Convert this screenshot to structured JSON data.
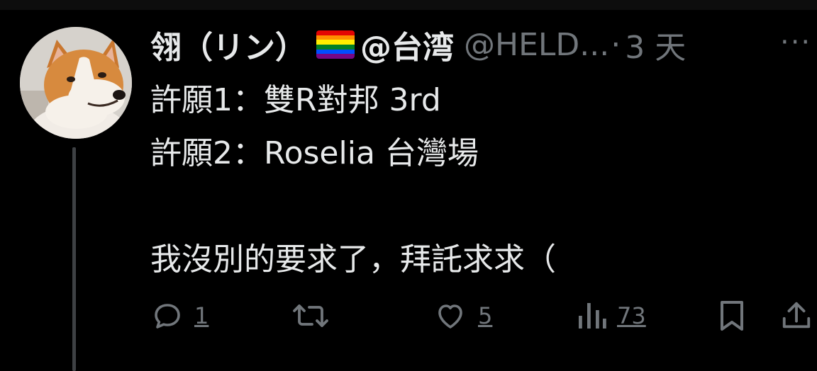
{
  "tweet": {
    "display_name": "翎（リン）",
    "name_suffix": "@台湾",
    "handle": "@HELD...",
    "separator": "·",
    "time": "3 天",
    "more_label": "···",
    "flag_colors": [
      "#e40303",
      "#ff8c00",
      "#ffed00",
      "#008026",
      "#004dff",
      "#750787"
    ],
    "lines": [
      "許願1：雙R對邦 3rd",
      "許願2：Roselia 台灣場",
      "",
      "我沒別的要求了，拜託求求（"
    ]
  },
  "actions": {
    "reply": {
      "icon": "reply-icon",
      "count": "1"
    },
    "retweet": {
      "icon": "retweet-icon",
      "count": ""
    },
    "like": {
      "icon": "heart-icon",
      "count": "5"
    },
    "views": {
      "icon": "views-icon",
      "count": "73"
    },
    "bookmark": {
      "icon": "bookmark-icon"
    },
    "share": {
      "icon": "share-icon"
    }
  },
  "colors": {
    "background": "#000000",
    "text": "#e7e9ea",
    "muted": "#71767b",
    "thread_line": "#3e4144"
  }
}
